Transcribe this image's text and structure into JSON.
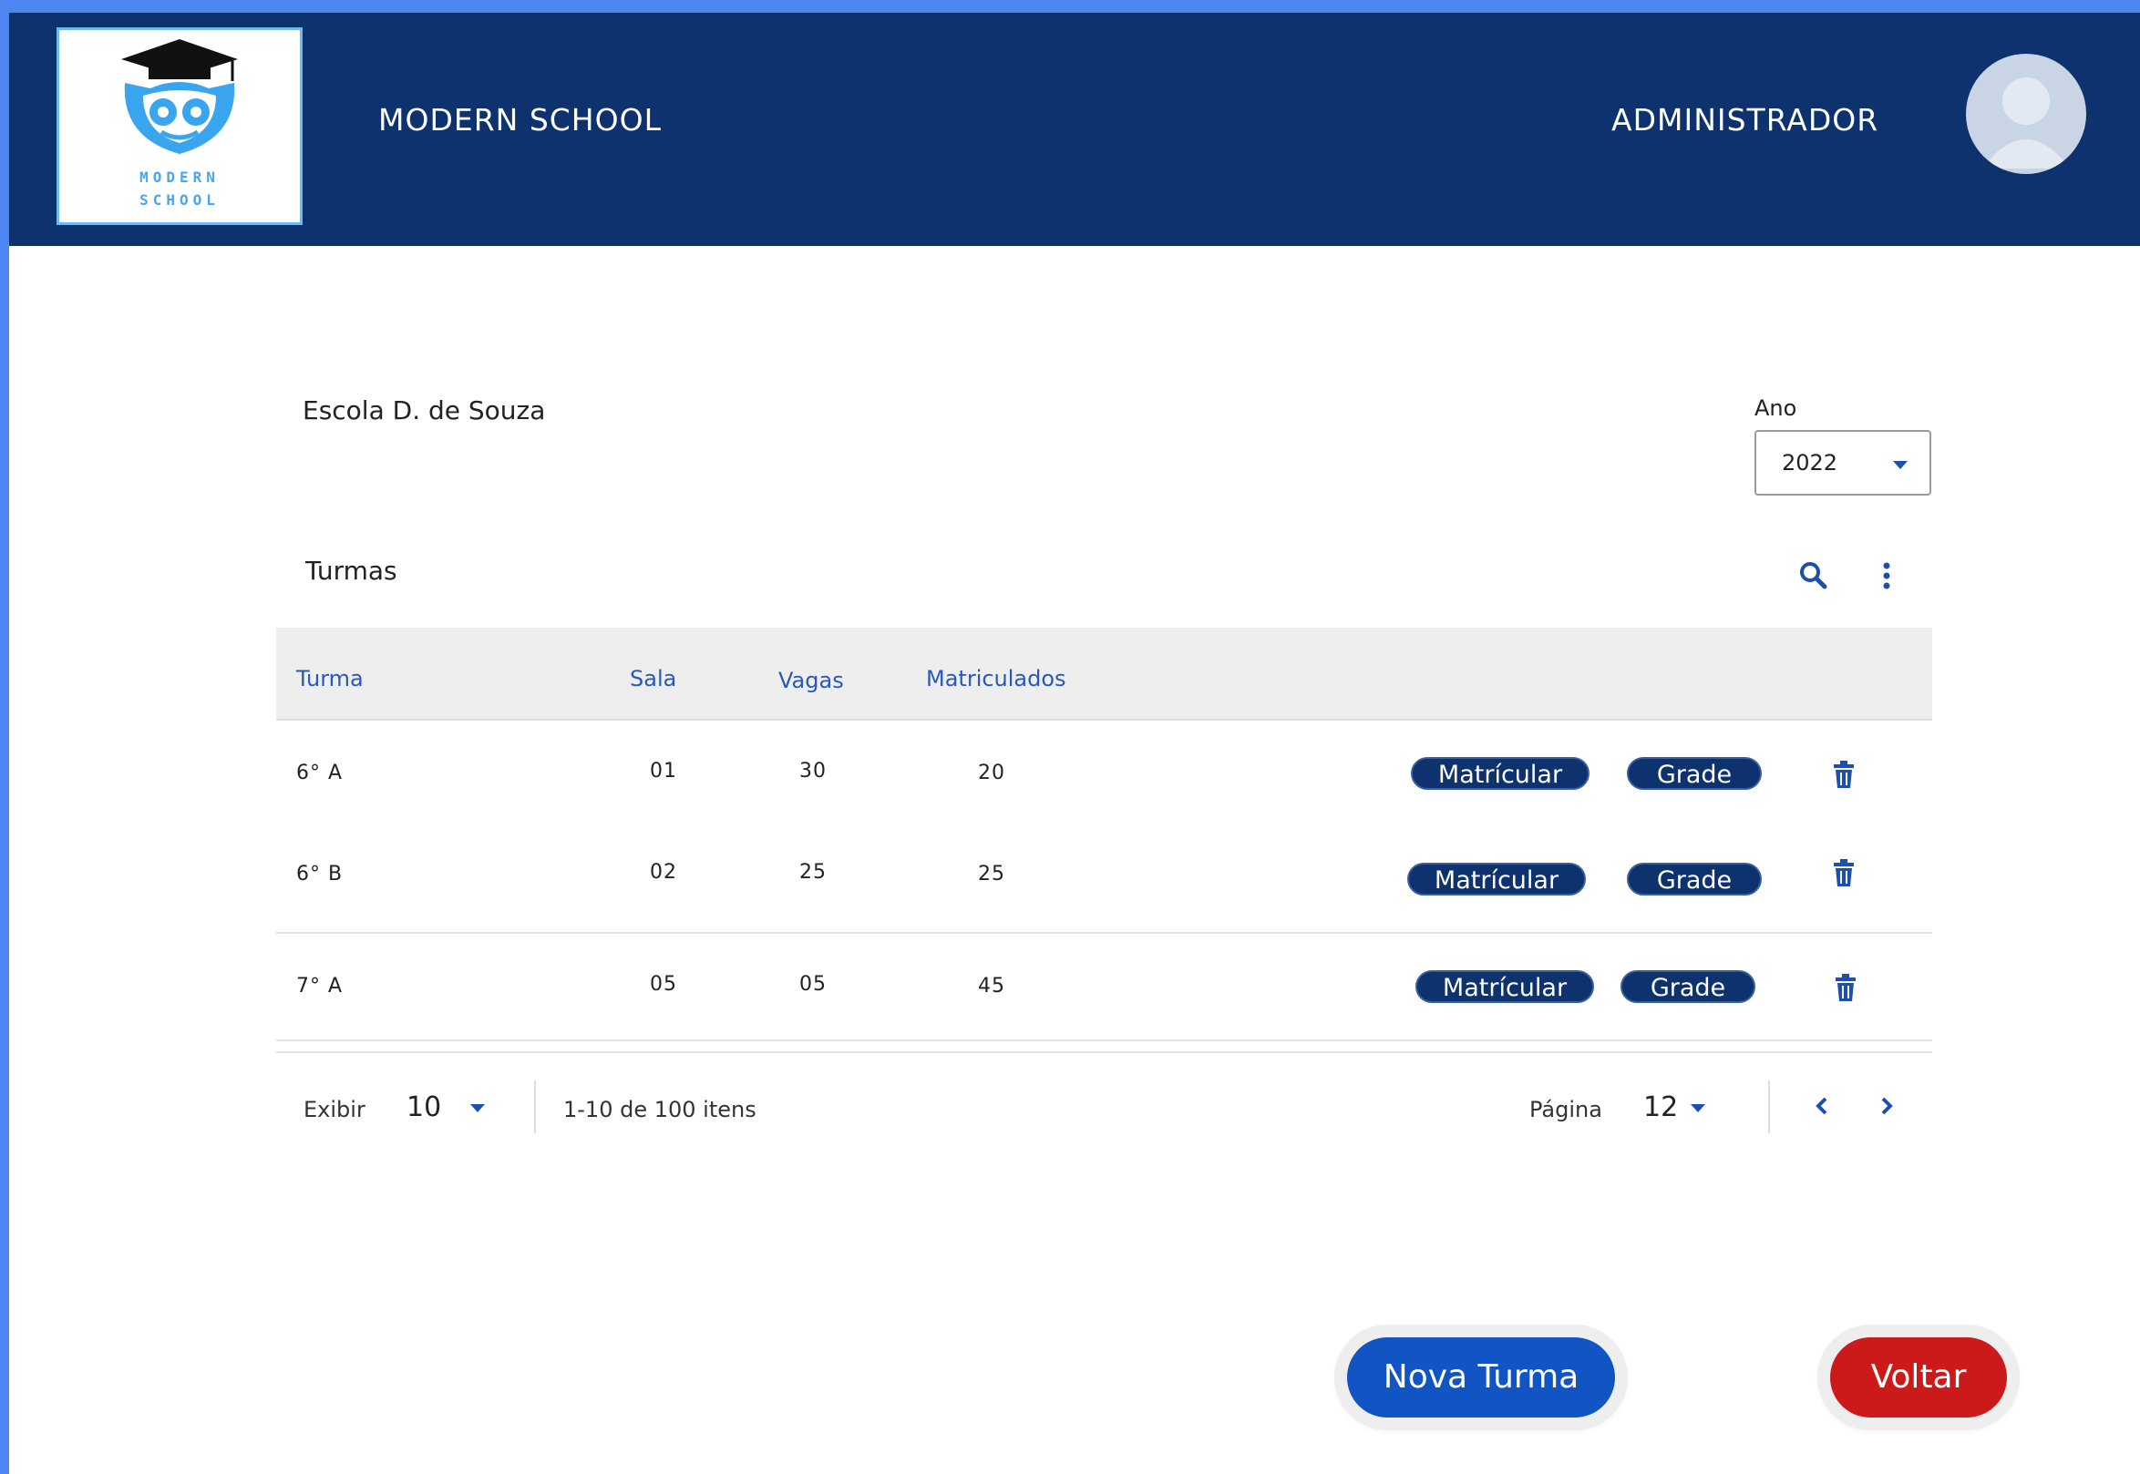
{
  "header": {
    "logo_text_line1": "MODERN",
    "logo_text_line2": "SCHOOL",
    "brand": "MODERN SCHOOL",
    "role": "ADMINISTRADOR"
  },
  "school": {
    "name": "Escola D. de Souza",
    "year_label": "Ano",
    "year_value": "2022"
  },
  "section": {
    "title": "Turmas"
  },
  "table": {
    "columns": [
      "Turma",
      "Sala",
      "Vagas",
      "Matriculados"
    ],
    "rows": [
      {
        "turma": "6° A",
        "sala": "01",
        "vagas": "30",
        "matriculados": "20",
        "enroll_label": "Matrícular",
        "grade_label": "Grade"
      },
      {
        "turma": "6° B",
        "sala": "02",
        "vagas": "25",
        "matriculados": "25",
        "enroll_label": "Matrícular",
        "grade_label": "Grade"
      },
      {
        "turma": "7° A",
        "sala": "05",
        "vagas": "05",
        "matriculados": "45",
        "enroll_label": "Matrícular",
        "grade_label": "Grade"
      }
    ]
  },
  "pagination": {
    "show_label": "Exibir",
    "show_value": "10",
    "range_text": "1-10 de 100 itens",
    "page_label": "Página",
    "page_value": "12"
  },
  "actions": {
    "new_label": "Nova Turma",
    "back_label": "Voltar"
  },
  "colors": {
    "header_bg": "#0d326e",
    "accent": "#1154c4",
    "danger": "#cc1a1a",
    "outer_frame": "#4d86f0"
  }
}
